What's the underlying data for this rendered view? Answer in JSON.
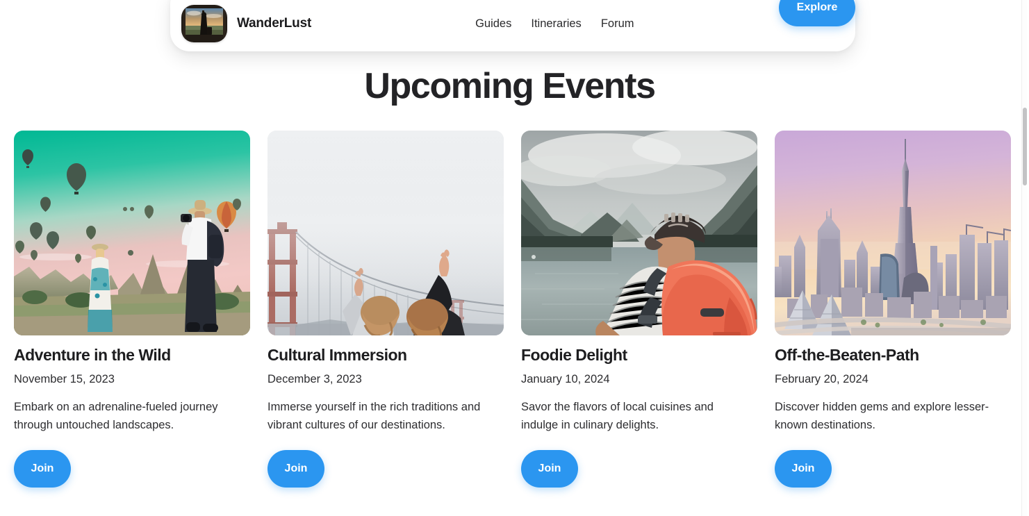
{
  "header": {
    "brand_name": "WanderLust",
    "logo_icon": "traveler-silhouette-logo",
    "nav": [
      {
        "label": "Guides",
        "name": "guides"
      },
      {
        "label": "Itineraries",
        "name": "itineraries"
      },
      {
        "label": "Forum",
        "name": "forum"
      }
    ],
    "explore_label": "Explore"
  },
  "main": {
    "page_title": "Upcoming Events",
    "join_label": "Join",
    "cards": [
      {
        "title": "Adventure in the Wild",
        "date": "November 15, 2023",
        "description": "Embark on an adrenaline-fueled journey through untouched landscapes.",
        "image_alt": "hot-air-balloons-over-cappadocia-with-two-travelers",
        "join_label": "Join"
      },
      {
        "title": "Cultural Immersion",
        "date": "December 3, 2023",
        "description": "Immerse yourself in the rich traditions and vibrant cultures of our destinations.",
        "image_alt": "two-women-making-peace-signs-before-foggy-golden-gate-bridge",
        "join_label": "Join"
      },
      {
        "title": "Foodie Delight",
        "date": "January 10, 2024",
        "description": "Savor the flavors of local cuisines and indulge in culinary delights.",
        "image_alt": "backpacker-with-orange-pack-facing-alpine-lake",
        "join_label": "Join"
      },
      {
        "title": "Off-the-Beaten-Path",
        "date": "February 20, 2024",
        "description": "Discover hidden gems and explore lesser-known destinations.",
        "image_alt": "dubai-skyline-with-burj-khalifa-at-sunset",
        "join_label": "Join"
      }
    ]
  },
  "colors": {
    "accent_blue": "#2b96f0",
    "page_background": "#ffffff",
    "heading_text": "#232326",
    "body_text": "#2d2d30"
  }
}
